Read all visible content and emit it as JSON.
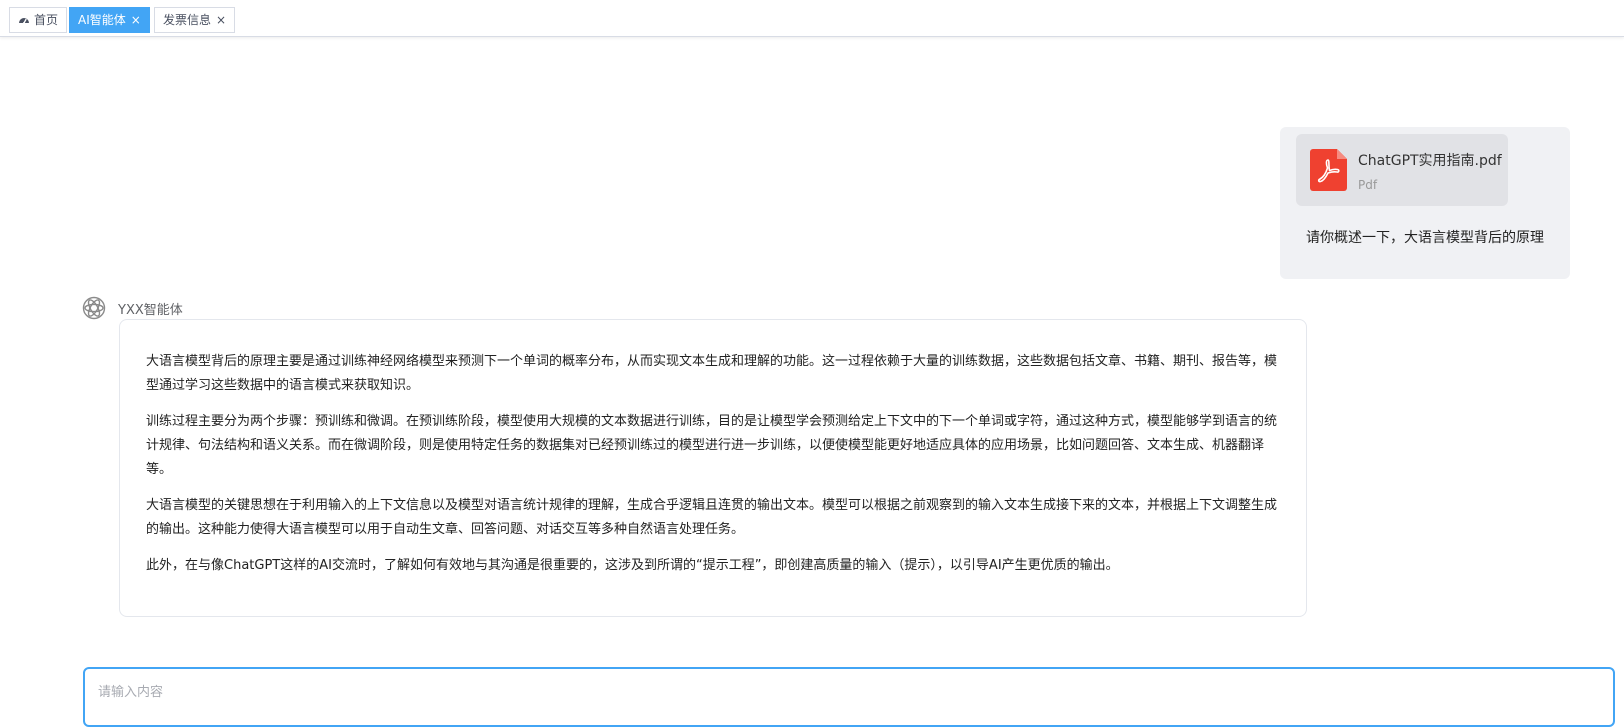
{
  "tabs": [
    {
      "label": "首页",
      "icon": "dashboard-icon",
      "active": false,
      "closable": false
    },
    {
      "label": "AI智能体",
      "active": true,
      "closable": true
    },
    {
      "label": "发票信息",
      "active": false,
      "closable": true
    }
  ],
  "close_glyph": "×",
  "user_message": {
    "file": {
      "name": "ChatGPT实用指南.pdf",
      "type": "Pdf",
      "icon": "pdf-file-icon",
      "icon_color": "#ef4130"
    },
    "text": "请你概述一下，大语言模型背后的原理"
  },
  "bot": {
    "name": "YXX智能体",
    "avatar_icon": "openai-logo-icon",
    "paragraphs": [
      "大语言模型背后的原理主要是通过训练神经网络模型来预测下一个单词的概率分布，从而实现文本生成和理解的功能。这一过程依赖于大量的训练数据，这些数据包括文章、书籍、期刊、报告等，模型通过学习这些数据中的语言模式来获取知识。",
      "训练过程主要分为两个步骤：预训练和微调。在预训练阶段，模型使用大规模的文本数据进行训练，目的是让模型学会预测给定上下文中的下一个单词或字符，通过这种方式，模型能够学到语言的统计规律、句法结构和语义关系。而在微调阶段，则是使用特定任务的数据集对已经预训练过的模型进行进一步训练，以便使模型能更好地适应具体的应用场景，比如问题回答、文本生成、机器翻译等。",
      "大语言模型的关键思想在于利用输入的上下文信息以及模型对语言统计规律的理解，生成合乎逻辑且连贯的输出文本。模型可以根据之前观察到的输入文本生成接下来的文本，并根据上下文调整生成的输出。这种能力使得大语言模型可以用于自动生文章、回答问题、对话交互等多种自然语言处理任务。",
      "此外，在与像ChatGPT这样的AI交流时，了解如何有效地与其沟通是很重要的，这涉及到所谓的“提示工程”，即创建高质量的输入（提示），以引导AI产生更优质的输出。"
    ]
  },
  "input": {
    "placeholder": "请输入内容",
    "value": ""
  },
  "colors": {
    "accent": "#42a5f5",
    "user_bubble": "#f0f1f4",
    "file_card": "#e1e2e6"
  }
}
